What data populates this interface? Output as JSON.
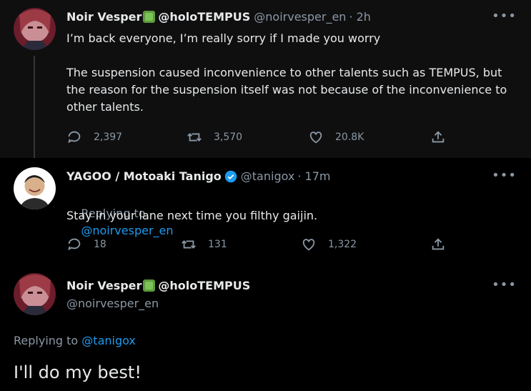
{
  "tweets": [
    {
      "name": "Noir Vesper",
      "handle_display": "@holoTEMPUS",
      "username": "@noirvesper_en",
      "time": "· 2h",
      "text": "I’m back everyone, I’m really sorry if I made you worry\n\nThe suspension caused inconvenience to other talents such as TEMPUS, but the reason for the suspension itself was not because of the inconvenience to other talents.",
      "replies": "2,397",
      "retweets": "3,570",
      "likes": "20.8K"
    },
    {
      "name": "YAGOO / Motoaki Tanigo",
      "username": "@tanigox",
      "time": "· 17m",
      "replying_to_label": "Replying to",
      "replying_to": "@noirvesper_en",
      "text": "Stay in your lane next time you filthy gaijin.",
      "replies": "18",
      "retweets": "131",
      "likes": "1,322"
    },
    {
      "name": "Noir Vesper",
      "handle_display": "@holoTEMPUS",
      "username": "@noirvesper_en",
      "replying_to_label": "Replying to",
      "replying_to": "@tanigox",
      "text": "I'll do my best!"
    }
  ],
  "icons": {
    "more": "more-icon",
    "reply": "reply-icon",
    "retweet": "retweet-icon",
    "like": "like-icon",
    "share": "share-icon",
    "verified": "verified-icon",
    "emoji": "green-book-emoji-icon"
  },
  "colors": {
    "link": "#1d9bf0",
    "muted": "#8b98a5",
    "text": "#e7e9ea",
    "background": "#000000"
  }
}
